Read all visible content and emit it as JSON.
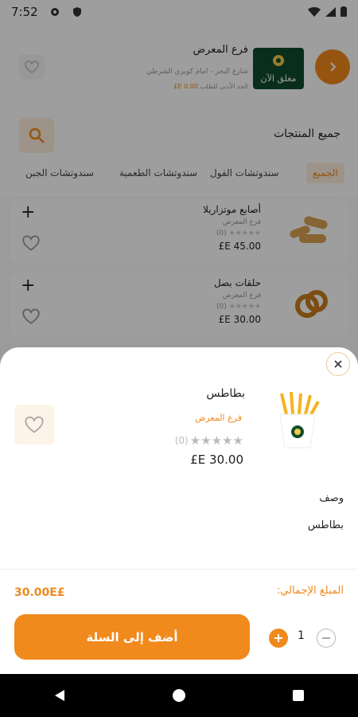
{
  "status_bar": {
    "time": "7:52"
  },
  "header": {
    "store_name": "فرع المعرض",
    "store_address": "شارع البحر - امام كوبري الشرطي",
    "min_order_label": "الحد الأدنى للطلب",
    "min_order_value": "0.00 E£",
    "logo_text": "مغلق الآن"
  },
  "section": {
    "title": "جميع المنتجات"
  },
  "tabs": [
    {
      "label": "الجميع"
    },
    {
      "label": "سندوتشات الفول"
    },
    {
      "label": "سندوتشات الطعمية"
    },
    {
      "label": "سندوتشات الجبن"
    }
  ],
  "products": [
    {
      "title": "أصابع موتزاريلا",
      "store": "فرع المعرض",
      "rating": "(0)",
      "price": "45.00 E£"
    },
    {
      "title": "حلقات بصل",
      "store": "فرع المعرض",
      "rating": "(0)",
      "price": "30.00 E£"
    }
  ],
  "sheet": {
    "product_name": "بطاطس",
    "store": "فرع المعرض",
    "rating": "(0)",
    "price": "30.00 E£",
    "description_label": "وصف",
    "description_text": "بطاطس",
    "total_label": "المبلغ الإجمالي:",
    "total_value": "30.00E£",
    "add_to_cart": "أضف إلى السلة",
    "quantity": "1"
  },
  "colors": {
    "accent": "#f08a1c"
  }
}
